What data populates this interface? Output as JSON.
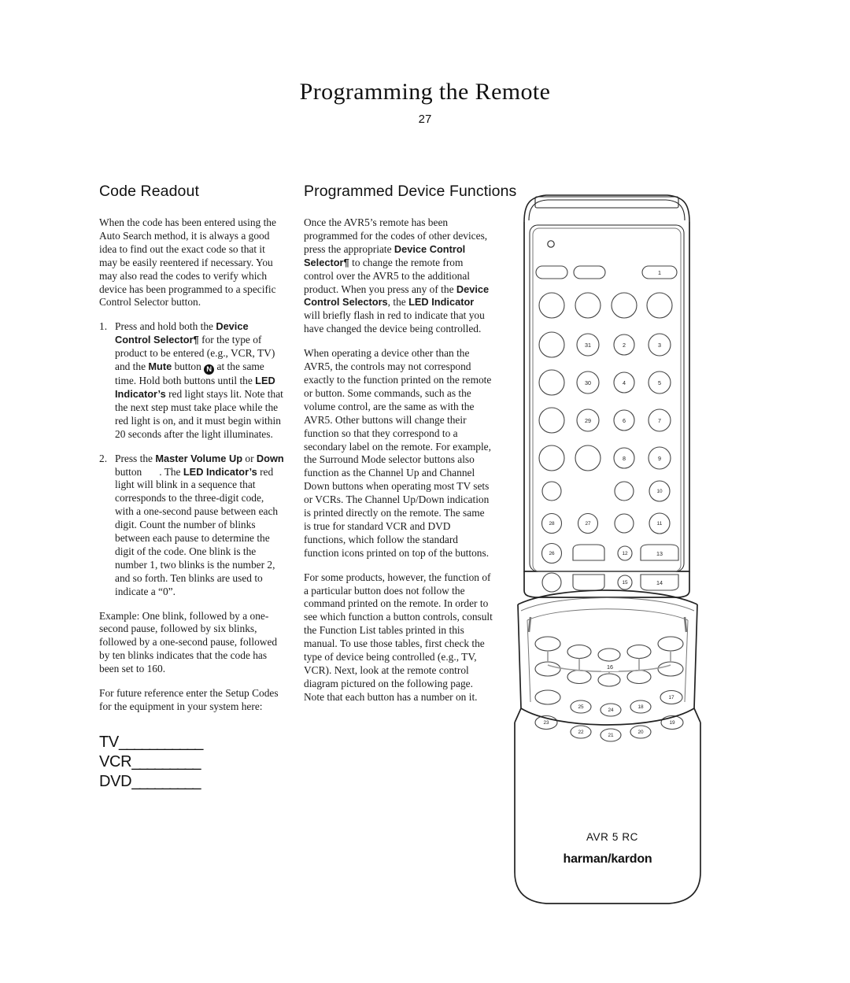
{
  "header": {
    "title": "Programming the Remote",
    "page_number": "27"
  },
  "left_column": {
    "heading": "Code Readout",
    "intro": "When the code has been entered using the Auto Search method, it is always a good idea to find out the exact code so that it may be easily reentered if necessary. You may also read the codes to verify which device has been programmed to a specific Control Selector button.",
    "steps": [
      {
        "number": "1.",
        "part1": "Press and hold both the ",
        "bold1": "Device Control Selector",
        "glyph1": "¶",
        "part2": " for the type of product to be entered (e.g., VCR, TV) and the ",
        "bold2": "Mute",
        "part3": " button ",
        "glyph2": "N",
        "part4": " at the same time. Hold both buttons until the ",
        "bold3": "LED Indicator’s",
        "part5": " red light stays lit. Note that the next step must take place while the red light is on, and it must begin within 20 seconds after the light illuminates."
      },
      {
        "number": "2.",
        "part1": "Press the ",
        "bold1": "Master Volume Up",
        "part2": " or ",
        "bold2": "Down",
        "part3": " button",
        "part4": ". The ",
        "bold3": "LED Indicator’s",
        "part5": " red light will blink in a sequence that corresponds to the three-digit code, with a one-second pause between each digit. Count the number of blinks between each pause to determine the digit of the code. One blink is the number 1, two blinks is the number 2, and so forth. Ten blinks are used to indicate a “0”."
      }
    ],
    "example": "Example: One blink, followed by a one-second pause, followed by six blinks, followed by a one-second pause, followed by ten blinks indicates that the code has been set to 160.",
    "future_reference": "For future reference enter the Setup Codes for the equipment in your system here:",
    "setup_code_fields": [
      {
        "label": "TV",
        "line": "___________"
      },
      {
        "label": "VCR",
        "line": "_________"
      },
      {
        "label": "DVD",
        "line": "_________"
      }
    ]
  },
  "right_column": {
    "heading": "Programmed Device Functions",
    "paragraph1": {
      "part1": "Once the AVR5’s remote has been programmed for the codes of other devices, press the appropriate ",
      "bold1": "Device Control Selector",
      "glyph1": "¶",
      "part2": " to change the remote from control over the AVR5 to the additional product. When you press any of the ",
      "bold2": "Device Control Selectors",
      "part3": ", the ",
      "bold3": "LED Indicator",
      "part4": " will briefly flash in red to indicate that you have changed the device being controlled."
    },
    "paragraph2": "When operating a device other than the AVR5, the controls may not correspond exactly to the function printed on the remote or button. Some commands, such as the volume control, are the same as with the AVR5. Other buttons will change their function so that they correspond to a secondary label on the remote. For example, the Surround Mode selector buttons also function as the Channel Up and Channel Down buttons when operating most TV sets or VCRs. The Channel Up/Down indication is printed directly on the remote. The same is true for standard VCR and DVD functions, which follow the standard function icons printed on top of the buttons.",
    "paragraph3": "For some products, however, the function of a particular button does not follow the command printed on the remote. In order to see which function a button controls, consult the Function List tables printed in this manual. To use those tables, first check the type of device being controlled (e.g., TV, VCR). Next, look at the remote control diagram pictured on the following page. Note that each button has a number on it."
  },
  "remote": {
    "model": "AVR 5 RC",
    "brand": "harman/kardon",
    "callouts": {
      "n1": "1",
      "n2": "2",
      "n3": "3",
      "n4": "4",
      "n5": "5",
      "n6": "6",
      "n7": "7",
      "n8": "8",
      "n9": "9",
      "n10": "10",
      "n11": "11",
      "n12": "12",
      "n13": "13",
      "n14": "14",
      "n15": "15",
      "n16": "16",
      "n17": "17",
      "n18": "18",
      "n19": "19",
      "n20": "20",
      "n21": "21",
      "n22": "22",
      "n23": "23",
      "n24": "24",
      "n25": "25",
      "n26": "26",
      "n27": "27",
      "n28": "28",
      "n29": "29",
      "n30": "30",
      "n31": "31"
    }
  },
  "colors": {
    "ink": "#1b1b1b",
    "outline": "#222222",
    "light_outline": "#9a9a9a",
    "page": "#ffffff"
  }
}
